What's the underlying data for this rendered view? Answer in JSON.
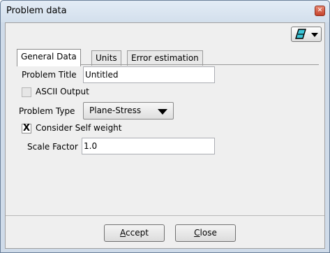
{
  "window": {
    "title": "Problem data"
  },
  "toolbar": {
    "icon": "eraser-icon"
  },
  "tabs": [
    {
      "label": "General Data"
    },
    {
      "label": "Units"
    },
    {
      "label": "Error estimation"
    }
  ],
  "general": {
    "problem_title_label": "Problem Title",
    "problem_title_value": "Untitled",
    "ascii_output_label": "ASCII Output",
    "ascii_output_checked": false,
    "problem_type_label": "Problem Type",
    "problem_type_value": "Plane-Stress",
    "self_weight_label": "Consider Self weight",
    "self_weight_checked": true,
    "self_weight_mark": "X",
    "scale_factor_label": "Scale Factor",
    "scale_factor_value": "1.0"
  },
  "buttons": {
    "accept_first": "A",
    "accept_rest": "ccept",
    "close_first": "C",
    "close_rest": "lose"
  }
}
